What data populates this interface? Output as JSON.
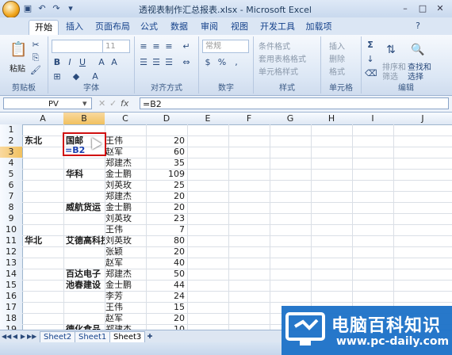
{
  "window": {
    "title": "透视表制作汇总报表.xlsx - Microsoft Excel"
  },
  "ribbon": {
    "tabs": [
      "开始",
      "插入",
      "页面布局",
      "公式",
      "数据",
      "审阅",
      "视图",
      "开发工具",
      "加载项"
    ],
    "active_tab": "开始",
    "groups": {
      "clipboard": {
        "label": "剪贴板",
        "paste": "粘贴"
      },
      "font": {
        "label": "字体",
        "size": "11"
      },
      "alignment": {
        "label": "对齐方式"
      },
      "number": {
        "label": "数字",
        "format": "常规"
      },
      "styles": {
        "label": "样式",
        "conditional": "条件格式",
        "table": "套用表格格式",
        "cell": "单元格样式"
      },
      "cells": {
        "label": "单元格",
        "insert": "插入",
        "delete": "删除",
        "format": "格式"
      },
      "editing": {
        "label": "编辑",
        "sort": "排序和",
        "filter": "筛选",
        "find": "查找和",
        "select": "选择"
      }
    }
  },
  "formula_bar": {
    "name_box": "PV",
    "formula": "=B2"
  },
  "columns": [
    "A",
    "B",
    "C",
    "D",
    "E",
    "F",
    "G",
    "H",
    "I",
    "J"
  ],
  "rows": [
    "1",
    "2",
    "3",
    "4",
    "5",
    "6",
    "7",
    "8",
    "9",
    "10",
    "11",
    "12",
    "13",
    "14",
    "15",
    "16",
    "17",
    "18",
    "19"
  ],
  "cells": {
    "A2": "东北",
    "B2": "国邮",
    "B3": "=B2",
    "B5": "华科",
    "B8": "威航货运",
    "A11": "华北",
    "B11": "艾德高科技",
    "B14": "百达电子",
    "B15": "池春建设",
    "B19": "德化食品",
    "C": [
      "王伟",
      "赵军",
      "郑建杰",
      "金士鹏",
      "刘英玫",
      "郑建杰",
      "金士鹏",
      "刘英玫",
      "王伟",
      "刘英玫",
      "张颖",
      "赵军",
      "郑建杰",
      "金士鹏",
      "李芳",
      "王伟",
      "赵军",
      "郑建杰"
    ],
    "D": [
      "20",
      "60",
      "35",
      "109",
      "25",
      "20",
      "20",
      "23",
      "7",
      "80",
      "20",
      "40",
      "50",
      "44",
      "24",
      "15",
      "20",
      "10"
    ]
  },
  "sheets": [
    "Sheet2",
    "Sheet1",
    "Sheet3"
  ],
  "active_sheet": "Sheet3",
  "watermark": {
    "name": "电脑百科知识",
    "url": "www.pc-daily.com"
  }
}
